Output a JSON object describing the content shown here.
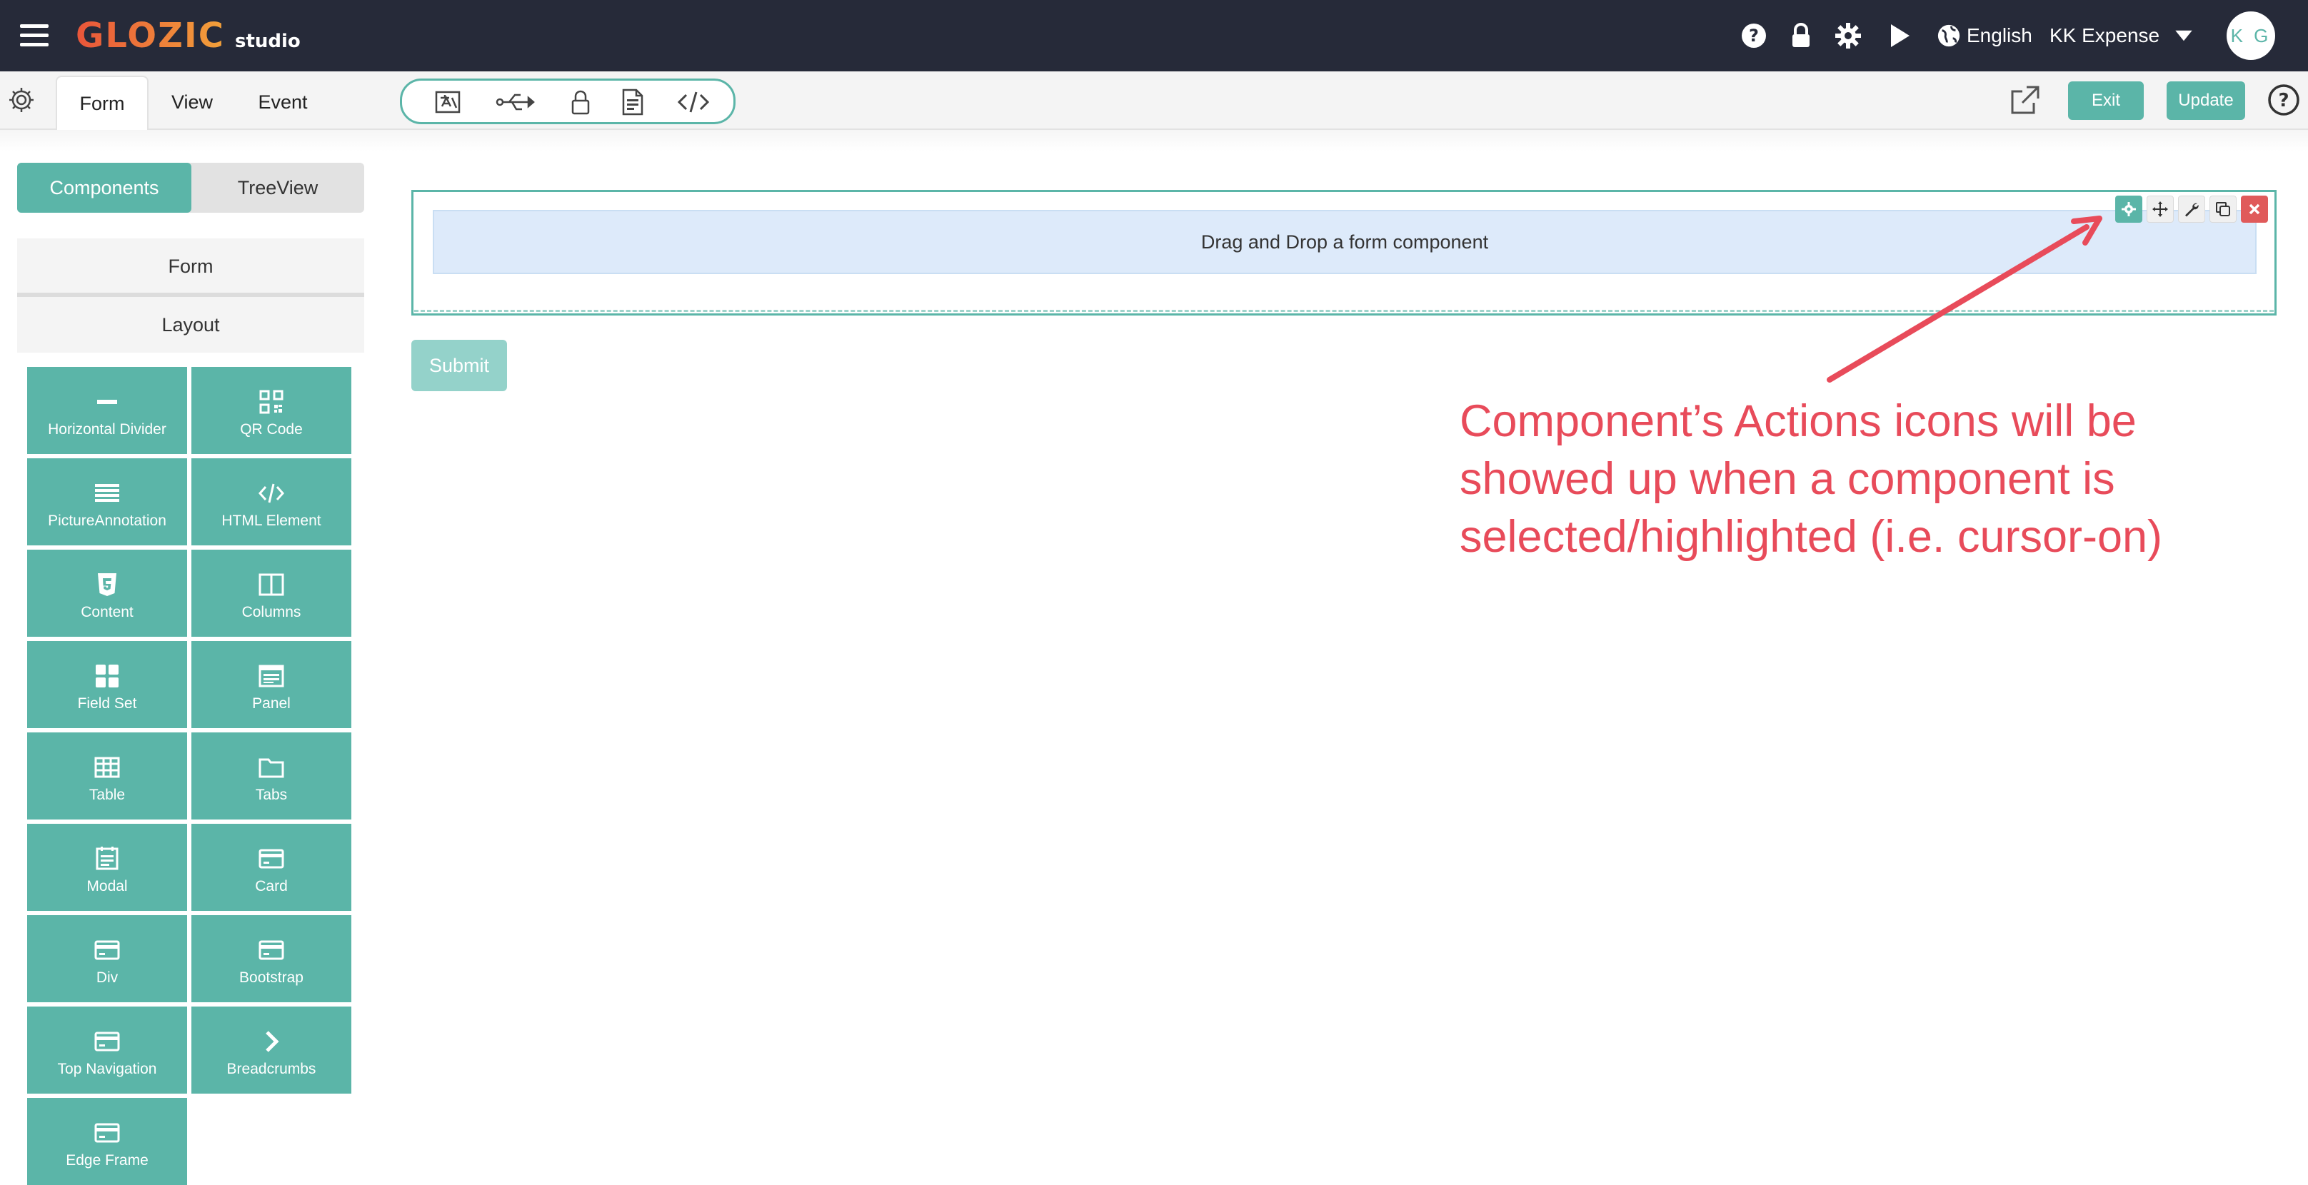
{
  "header": {
    "logo_main": "GLOZIC",
    "logo_sub": "studio",
    "language": "English",
    "account": "KK Expense",
    "avatar_initials": "K G",
    "icons": [
      "menu-icon",
      "help-icon",
      "lock-icon",
      "settings-icon",
      "play-icon",
      "globe-icon",
      "caret-down-icon"
    ]
  },
  "tabs": [
    {
      "label": "Form",
      "active": true
    },
    {
      "label": "View",
      "active": false
    },
    {
      "label": "Event",
      "active": false
    }
  ],
  "toolbar": {
    "tools": [
      "translate-icon",
      "usb-icon",
      "lock-icon",
      "document-icon",
      "code-icon"
    ],
    "exit_label": "Exit",
    "update_label": "Update"
  },
  "sidebar": {
    "segments": [
      {
        "label": "Components",
        "active": true
      },
      {
        "label": "TreeView",
        "active": false
      }
    ],
    "groups": [
      "Form",
      "Layout"
    ],
    "components": [
      {
        "label": "Horizontal Divider",
        "icon": "minus-icon"
      },
      {
        "label": "QR Code",
        "icon": "qrcode-icon"
      },
      {
        "label": "PictureAnnotation",
        "icon": "list-icon"
      },
      {
        "label": "HTML Element",
        "icon": "code-icon"
      },
      {
        "label": "Content",
        "icon": "html5-icon"
      },
      {
        "label": "Columns",
        "icon": "columns-icon"
      },
      {
        "label": "Field Set",
        "icon": "grid-icon"
      },
      {
        "label": "Panel",
        "icon": "panel-icon"
      },
      {
        "label": "Table",
        "icon": "table-icon"
      },
      {
        "label": "Tabs",
        "icon": "folder-icon"
      },
      {
        "label": "Modal",
        "icon": "modal-icon"
      },
      {
        "label": "Card",
        "icon": "card-icon"
      },
      {
        "label": "Div",
        "icon": "card-icon"
      },
      {
        "label": "Bootstrap",
        "icon": "card-icon"
      },
      {
        "label": "Top Navigation",
        "icon": "card-icon"
      },
      {
        "label": "Breadcrumbs",
        "icon": "chevron-right-icon"
      },
      {
        "label": "Edge Frame",
        "icon": "card-icon"
      }
    ]
  },
  "canvas": {
    "dropzone_text": "Drag and Drop a form component",
    "actions": [
      "gear-icon",
      "move-icon",
      "wrench-icon",
      "copy-icon",
      "remove-icon"
    ],
    "submit_label": "Submit"
  },
  "annotation": {
    "text": "Component’s Actions icons will be showed up when a component is selected/highlighted (i.e. cursor-on)",
    "color": "#e84b5a"
  },
  "colors": {
    "accent": "#5bb5a8",
    "header_bg": "#262a39",
    "danger": "#e05a5a"
  }
}
